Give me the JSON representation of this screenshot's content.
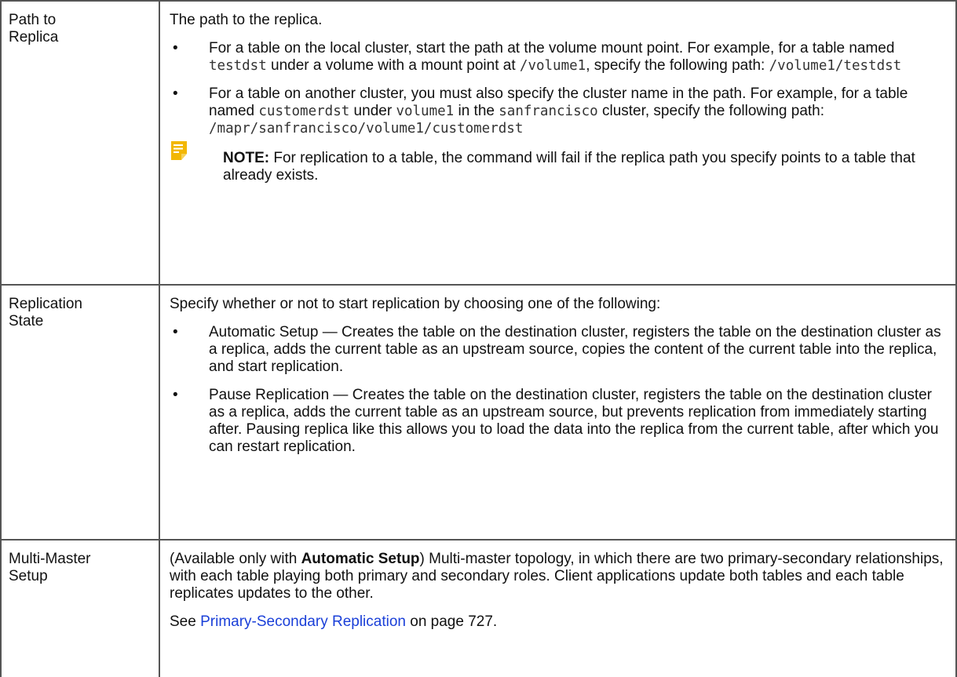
{
  "rows": [
    {
      "term_line1": "Path to",
      "term_line2": "Replica",
      "intro": "The path to the replica.",
      "bullet1": {
        "t1": "For a table on the local cluster, start the path at the volume mount point. For example, for a table named ",
        "c1": "testdst",
        "t2": " under a volume with a mount point at ",
        "c2": "/volume1",
        "t3": ", specify the following path: ",
        "c3": "/volume1/testdst"
      },
      "bullet2": {
        "t1": "For a table on another cluster, you must also specify the cluster name in the path. For example, for a table named ",
        "c1": "customerdst",
        "t2": " under ",
        "c2": "volume1",
        "t3": " in the ",
        "c3": "sanfrancisco",
        "t4": " cluster, specify the following path: ",
        "c4": "/mapr/sanfrancisco/volume1/customerdst"
      },
      "note": {
        "icon": "note-icon",
        "label": "NOTE:",
        "text": " For replication to a table, the command will fail if the replica path you specify points to a table that already exists."
      }
    },
    {
      "term_line1": "Replication",
      "term_line2": "State",
      "intro": "Specify whether or not to start replication by choosing one of the following:",
      "bullet1": "Automatic Setup — Creates the table on the destination cluster, registers the table on the destination cluster as a replica, adds the current table as an upstream source, copies the content of the current table into the replica, and start replication.",
      "bullet2": "Pause Replication — Creates the table on the destination cluster, registers the table on the destination cluster as a replica, adds the current table as an upstream source, but prevents replication from immediately starting after. Pausing replica like this allows you to load the data into the replica from the current table, after which you can restart replication."
    },
    {
      "term_line1": "Multi-Master",
      "term_line2": "Setup",
      "p1_pre": "(Available only with ",
      "p1_bold": "Automatic Setup",
      "p1_post": ") Multi-master topology, in which there are two primary-secondary relationships, with each table playing both primary and secondary roles. Client applications update both tables and each table replicates updates to the other.",
      "p2_pre": "See ",
      "p2_link": "Primary-Secondary Replication",
      "p2_post": " on page 727."
    }
  ],
  "bullet_char": "•",
  "colors": {
    "link": "#1a3fd8",
    "note_icon": "#f2b705",
    "border": "#555555"
  }
}
